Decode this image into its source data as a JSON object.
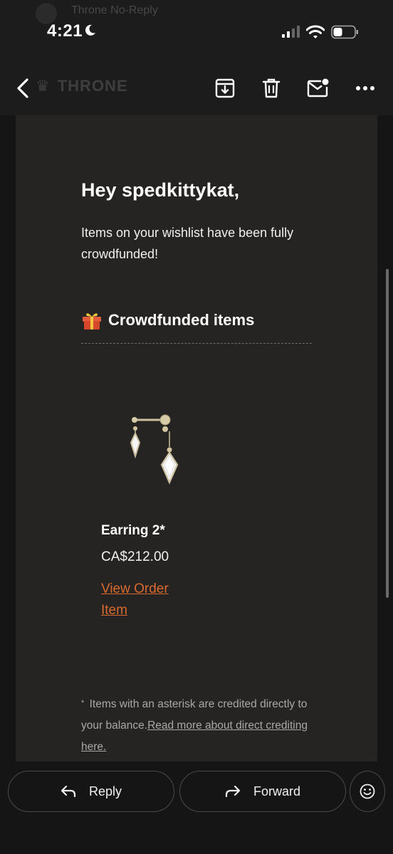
{
  "status_bar": {
    "time": "4:21",
    "ghost_sender": "Throne No-Reply"
  },
  "toolbar": {
    "ghost_logo": "THRONE"
  },
  "email": {
    "greeting": "Hey spedkittykat,",
    "intro": "Items on your wishlist have been fully crowdfunded!",
    "section_title": "Crowdfunded items",
    "item": {
      "name": "Earring 2*",
      "price": "CA$212.00",
      "link_label": "View Order Item"
    },
    "footnote": {
      "asterisk": "*",
      "text": " Items with an asterisk are credited directly to your balance.",
      "link": "Read more about direct crediting here."
    }
  },
  "actions": {
    "reply": "Reply",
    "forward": "Forward"
  },
  "colors": {
    "link": "#d86a2e",
    "card": "#262422",
    "background": "#151515"
  }
}
